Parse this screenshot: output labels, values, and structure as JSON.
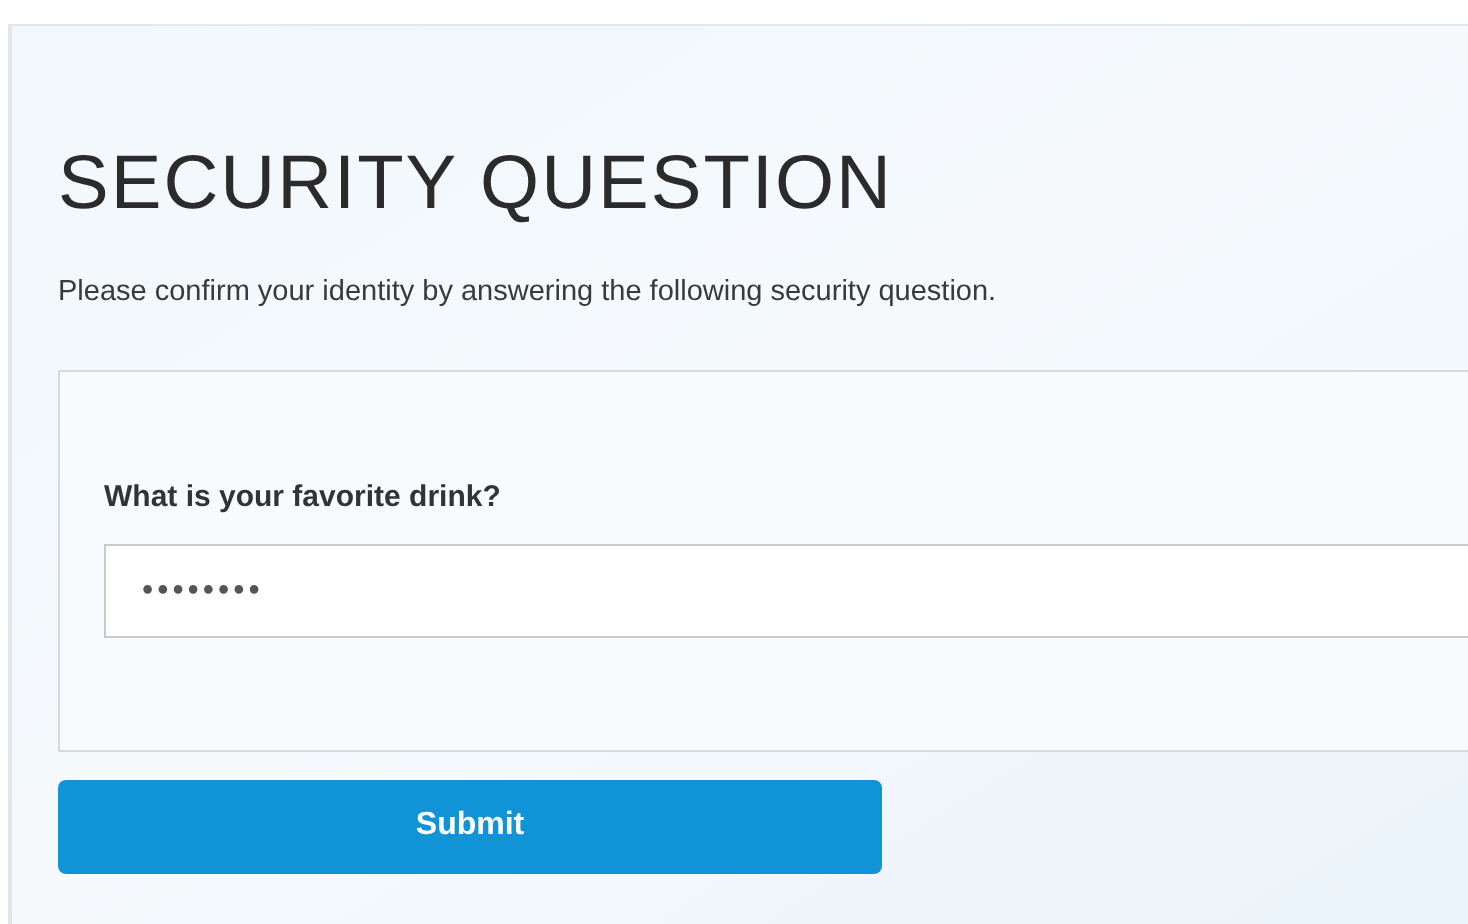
{
  "title": "SECURITY QUESTION",
  "instructions": "Please confirm your identity by answering the following security question.",
  "question": {
    "label": "What is your favorite drink?",
    "value": "••••••••"
  },
  "submit_button": "Submit"
}
